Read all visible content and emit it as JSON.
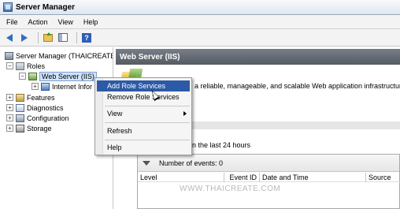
{
  "window": {
    "title": "Server Manager"
  },
  "menu": {
    "items": [
      "File",
      "Action",
      "View",
      "Help"
    ]
  },
  "toolbar": {
    "help_label": "?"
  },
  "tree": {
    "root": "Server Manager (THAICREATE",
    "roles": "Roles",
    "web_server": "Web Server (IIS)",
    "internet_info": "Internet Infor",
    "features": "Features",
    "diagnostics": "Diagnostics",
    "configuration": "Configuration",
    "storage": "Storage",
    "expand_minus": "−",
    "expand_plus": "+"
  },
  "main": {
    "header": "Web Server (IIS)",
    "description": "a reliable, manageable, and scalable Web application infrastructure",
    "events_caption": "in the last 24 hours",
    "events_count": "Number of events: 0",
    "columns": [
      "Level",
      "Event ID",
      "Date and Time",
      "Source"
    ],
    "watermark": "WWW.THAICREATE.COM"
  },
  "context_menu": {
    "add_role_services": "Add Role Services",
    "remove_role_services": "Remove Role Services",
    "view": "View",
    "refresh": "Refresh",
    "help": "Help"
  }
}
